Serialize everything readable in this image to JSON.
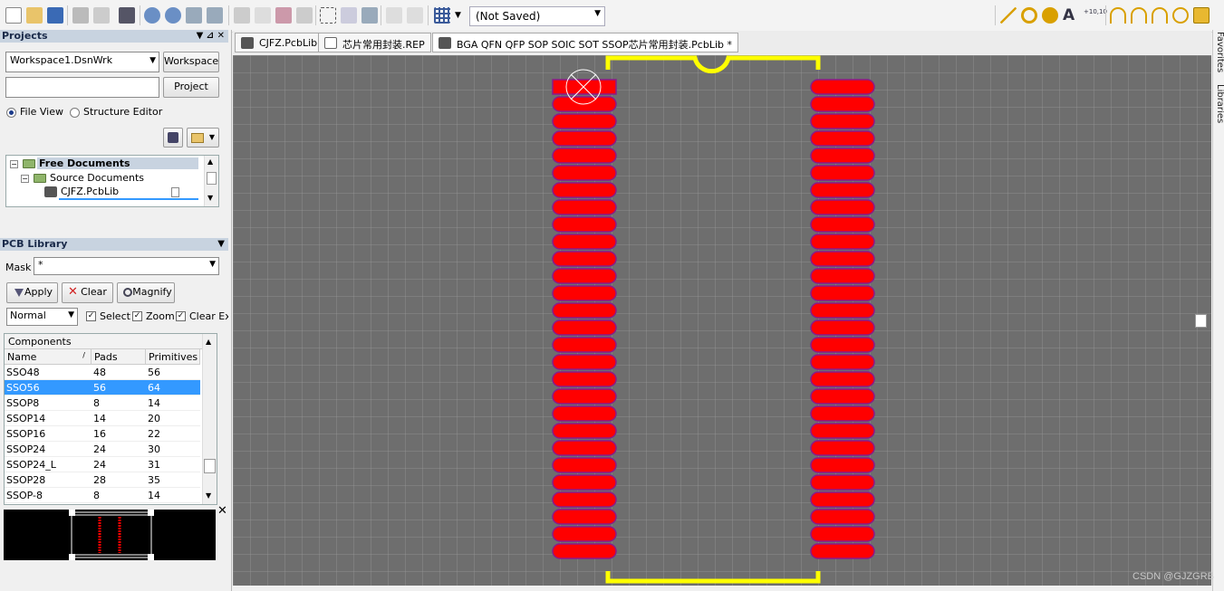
{
  "toolbar": {
    "doc_state": "(Not Saved)"
  },
  "projects": {
    "title": "Projects",
    "workspace_value": "Workspace1.DsnWrk",
    "workspace_button": "Workspace",
    "project_value": "",
    "project_button": "Project",
    "view_file": "File View",
    "view_structure": "Structure Editor",
    "tree": {
      "free_documents": "Free Documents",
      "source_documents": "Source Documents",
      "file": "CJFZ.PcbLib"
    }
  },
  "pcb_library": {
    "title": "PCB Library",
    "mask_label": "Mask",
    "mask_value": "*",
    "apply": "Apply",
    "clear": "Clear",
    "magnify": "Magnify",
    "mode_value": "Normal",
    "select": "Select",
    "zoom": "Zoom",
    "clear_existing": "Clear Exi",
    "components_title": "Components",
    "columns": [
      "Name",
      "Pads",
      "Primitives"
    ],
    "rows": [
      {
        "name": "SSO48",
        "pads": "48",
        "prims": "56"
      },
      {
        "name": "SSO56",
        "pads": "56",
        "prims": "64"
      },
      {
        "name": "SSOP8",
        "pads": "8",
        "prims": "14"
      },
      {
        "name": "SSOP14",
        "pads": "14",
        "prims": "20"
      },
      {
        "name": "SSOP16",
        "pads": "16",
        "prims": "22"
      },
      {
        "name": "SSOP24",
        "pads": "24",
        "prims": "30"
      },
      {
        "name": "SSOP24_L",
        "pads": "24",
        "prims": "31"
      },
      {
        "name": "SSOP28",
        "pads": "28",
        "prims": "35"
      },
      {
        "name": "SSOP-8",
        "pads": "8",
        "prims": "14"
      }
    ],
    "selected_index": 1
  },
  "tabs": [
    "CJFZ.PcbLib",
    "芯片常用封装.REP",
    "BGA QFN QFP SOP SOIC SOT SSOP芯片常用封装.PcbLib *"
  ],
  "side_tabs": {
    "favorites": "Favorites",
    "libraries": "Libraries"
  },
  "footprint": {
    "pads_per_side": 28,
    "grid_color": "#6e6e6e",
    "pad_color": "#ff0000",
    "pad_outline": "#8a1a8a",
    "silk_color": "#ffff00"
  },
  "watermark": "CSDN @GJZGRB"
}
